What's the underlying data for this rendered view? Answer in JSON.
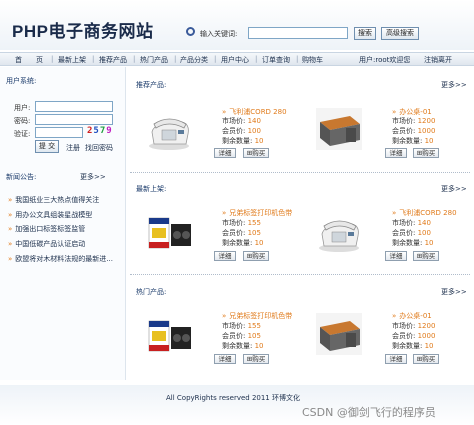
{
  "header": {
    "logo": "PHP电子商务网站",
    "search_label": "输入关键词:",
    "search_value": "",
    "search_button": "搜索",
    "advanced_search_button": "高级搜索"
  },
  "nav": {
    "items": [
      "首　　页",
      "最新上架",
      "推荐产品",
      "热门产品",
      "产品分类",
      "用户中心",
      "订单查询",
      "购物车"
    ],
    "user_status": "用户:root欢迎您",
    "logout": "注销离开"
  },
  "login": {
    "title": "用户系统:",
    "username_label": "用户:",
    "password_label": "密码:",
    "captcha_label": "验证:",
    "captcha_digits": [
      "2",
      "5",
      "7",
      "9"
    ],
    "captcha_colors": [
      "#d02020",
      "#2050c0",
      "#20a040",
      "#c020c0"
    ],
    "login_button": "提 交",
    "register_link": "注册",
    "recover_link": "找回密码"
  },
  "news": {
    "title": "新闻公告:",
    "more": "更多>>",
    "items": [
      "我国纸业三大热点值得关注",
      "用办公文具组装星战模型",
      "加强出口标签标签监管",
      "中国低碳产品认证启动",
      "欧盟将对木材料法规的最新进..."
    ]
  },
  "labels": {
    "market_price": "市场价:",
    "member_price": "会员价:",
    "stock": "剩余数量:",
    "detail_button": "详细",
    "buy_button": "购买"
  },
  "sections": [
    {
      "title": "推荐产品:",
      "more": "更多>>",
      "products": [
        {
          "name": "飞利浦CORD 280",
          "image": "phone-icon",
          "market_price": "140",
          "member_price": "100",
          "stock": "10"
        },
        {
          "name": "办公桌-01",
          "image": "desk-icon",
          "market_price": "1200",
          "member_price": "1000",
          "stock": "10"
        }
      ]
    },
    {
      "title": "最新上架:",
      "more": "更多>>",
      "products": [
        {
          "name": "兄弟标签打印机色带",
          "image": "tape-icon",
          "market_price": "155",
          "member_price": "105",
          "stock": "10"
        },
        {
          "name": "飞利浦CORD 280",
          "image": "phone-icon",
          "market_price": "140",
          "member_price": "100",
          "stock": "10"
        }
      ]
    },
    {
      "title": "热门产品:",
      "more": "更多>>",
      "products": [
        {
          "name": "兄弟标签打印机色带",
          "image": "tape-icon",
          "market_price": "155",
          "member_price": "105",
          "stock": "10"
        },
        {
          "name": "办公桌-01",
          "image": "desk-icon",
          "market_price": "1200",
          "member_price": "1000",
          "stock": "10"
        }
      ]
    }
  ],
  "footer": {
    "copyright": "All CopyRights reserved 2011 环博文化"
  },
  "watermark": "CSDN @御剑飞行的程序员"
}
